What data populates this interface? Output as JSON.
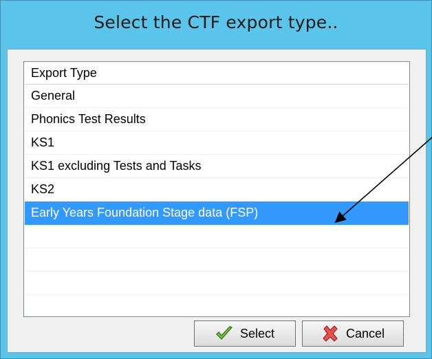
{
  "window": {
    "title": "Select the CTF export type.."
  },
  "list": {
    "column_header": "Export Type",
    "items": [
      {
        "label": "General"
      },
      {
        "label": "Phonics Test Results"
      },
      {
        "label": "KS1"
      },
      {
        "label": "KS1 excluding Tests and Tasks"
      },
      {
        "label": "KS2"
      },
      {
        "label": "Early Years Foundation Stage data (FSP)",
        "selected": true
      }
    ]
  },
  "buttons": {
    "select_label": "Select",
    "cancel_label": "Cancel"
  },
  "icons": {
    "select": "checkmark-icon",
    "cancel": "red-x-icon"
  },
  "colors": {
    "title_bar": "#5bc4ea",
    "selection": "#3399ff"
  }
}
